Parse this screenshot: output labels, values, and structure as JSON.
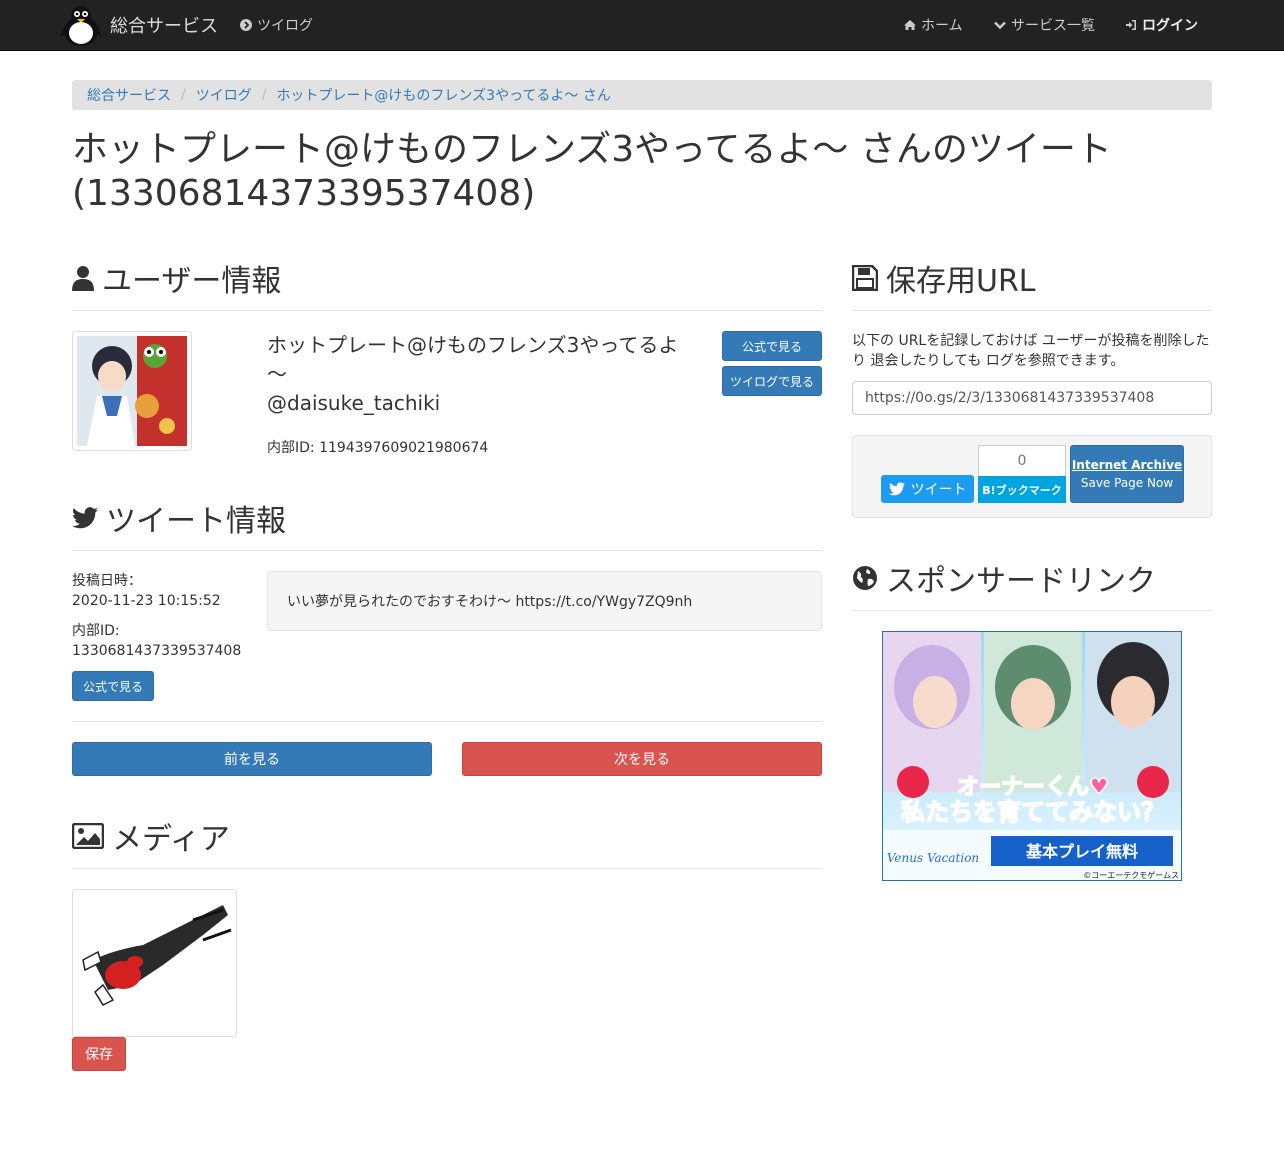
{
  "navbar": {
    "brand": "総合サービス",
    "logo_char": "総",
    "twilog": "ツイログ",
    "home": "ホーム",
    "services": "サービス一覧",
    "login": "ログイン"
  },
  "breadcrumb": {
    "items": [
      "総合サービス",
      "ツイログ",
      "ホットプレート@けものフレンズ3やってるよ～&#xfe0f; さん"
    ]
  },
  "page_title": "ホットプレート@けものフレンズ3やってるよ～&#xfe0f; さんのツイート (1330681437339537408)",
  "user_info": {
    "heading": "ユーザー情報",
    "display_name": "ホットプレート@けものフレンズ3やってるよ～&#xfe0f;",
    "screen_name": "@daisuke_tachiki",
    "internal_id": "内部ID: 1194397609021980674",
    "official_button": "公式で見る",
    "twilog_button": "ツイログで見る"
  },
  "tweet_info": {
    "heading": "ツイート情報",
    "posted_label": "投稿日時：",
    "posted_value": "2020-11-23 10:15:52",
    "internal_label": "内部ID:",
    "internal_value": "1330681437339537408",
    "official_button": "公式で見る",
    "text": "いい夢が見られたのでおすそわけ～ https://t.co/YWgy7ZQ9nh"
  },
  "pager": {
    "prev": "前を見る",
    "next": "次を見る"
  },
  "media": {
    "heading": "メディア",
    "save_button": "保存"
  },
  "save_url": {
    "heading": "保存用URL",
    "description": "以下の URLを記録しておけば ユーザーが投稿を削除したり 退会したりしても ログを参照できます。",
    "url": "https://0o.gs/2/3/1330681437339537408"
  },
  "share": {
    "tweet": "ツイート",
    "hatena_count": "0",
    "hatena": "B!ブックマーク",
    "ia_title": "Internet Archive",
    "ia_sub": "Save Page Now"
  },
  "sponsor": {
    "heading": "スポンサードリンク",
    "ad_line1": "オーナーくん♥",
    "ad_line2": "私たちを育ててみない？",
    "ad_logo": "Venus Vacation",
    "ad_cta": "基本プレイ無料",
    "ad_copyright": "©コーエーテクモゲームス"
  }
}
